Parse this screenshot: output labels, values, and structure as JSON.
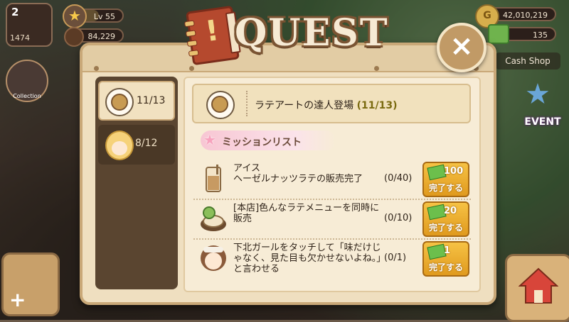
{
  "hud": {
    "player_level_box": "2",
    "player_sub": "1474",
    "level_label": "Lv 55",
    "beans": "84,229",
    "gold": "42,010,219",
    "cash": "135",
    "cash_shop": "Cash Shop",
    "event": "EVENT",
    "collection": "Collection"
  },
  "modal": {
    "title": "QUEST",
    "close_glyph": "×"
  },
  "sidebar": {
    "tabs": [
      {
        "label": "11/13",
        "active": true,
        "icon": "latte-cup-icon"
      },
      {
        "label": "8/12",
        "active": false,
        "icon": "character-portrait-icon"
      }
    ]
  },
  "quest_header": {
    "title": "ラテアートの達人登場",
    "progress": "(11/13)"
  },
  "mission_list": {
    "title": "ミッションリスト",
    "items": [
      {
        "description": "アイス\nヘーゼルナッツラテの販売完了",
        "progress": "(0/40)",
        "reward": "100",
        "button": "完了する"
      },
      {
        "description": "[本店]色んなラテメニューを同時に販売",
        "progress": "(0/10)",
        "reward": "20",
        "button": "完了する"
      },
      {
        "description": "下北ガールをタッチして「味だけじゃなく、見た目も欠かせないよね。」と言わせる",
        "progress": "(0/1)",
        "reward": "1",
        "button": "完了する"
      }
    ]
  }
}
